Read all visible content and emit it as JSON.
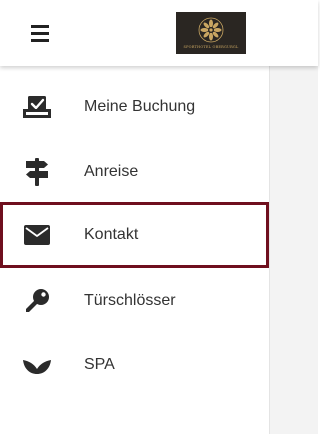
{
  "header": {
    "menu_icon": "hamburger-icon",
    "logo_text": "SPORTHOTEL OBERGURGL"
  },
  "menu": {
    "items": [
      {
        "label": "Meine Buchung",
        "icon": "calendar-check-icon",
        "active": false
      },
      {
        "label": "Anreise",
        "icon": "signpost-icon",
        "active": false
      },
      {
        "label": "Kontakt",
        "icon": "envelope-icon",
        "active": true
      },
      {
        "label": "Türschlösser",
        "icon": "key-icon",
        "active": false
      },
      {
        "label": "SPA",
        "icon": "spa-leaf-icon",
        "active": false
      }
    ]
  },
  "colors": {
    "accent": "#6f0f1e",
    "logo_background": "#2a2622",
    "logo_gold": "#c9a662"
  }
}
